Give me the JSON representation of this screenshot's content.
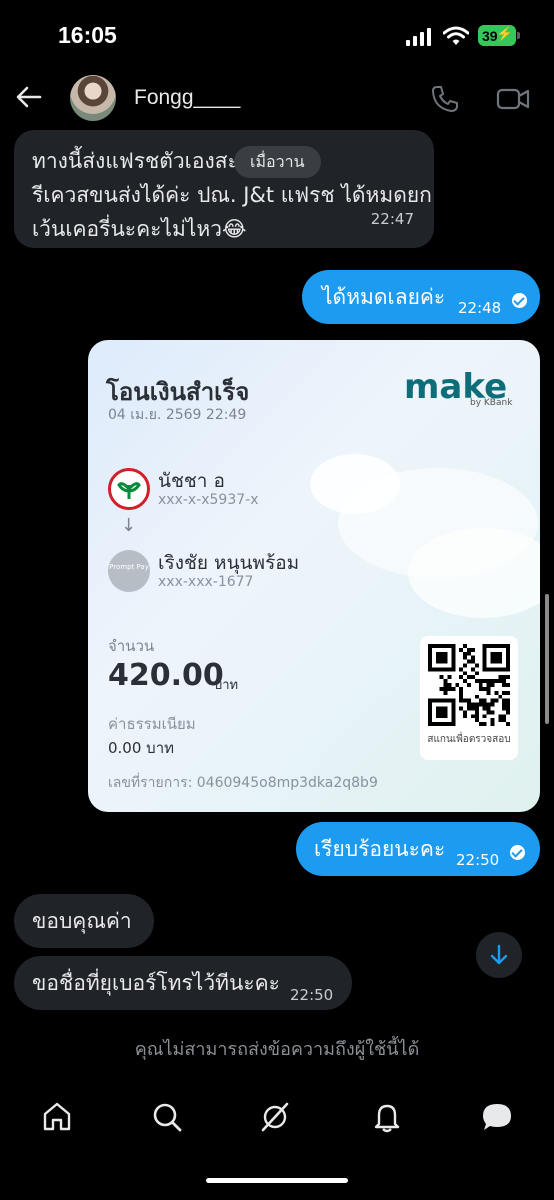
{
  "status": {
    "time": "16:05",
    "battery": "39"
  },
  "header": {
    "name": "Fongg____"
  },
  "timestamp_pill": "เมื่อวาน",
  "messages": [
    {
      "line1": "ทางนี้ส่งแฟรชตัวเองสะดวกกว่า",
      "line2": "รีเควสขนส่งได้ค่ะ ปณ. J&t แฟรช ได้หมดยก",
      "line3": "เว้นเคอรี่นะคะไม่ไหว😂",
      "time": "22:47"
    },
    {
      "text": "ได้หมดเลยค่ะ",
      "time": "22:48"
    },
    {
      "text": "เรียบร้อยนะคะ",
      "time": "22:50"
    },
    {
      "text": "ขอบคุณค่า"
    },
    {
      "text": "ขอชื่อที่ยุเบอร์โทรไว้ทีนะคะ",
      "time": "22:50"
    }
  ],
  "receipt": {
    "title": "โอนเงินสำเร็จ",
    "date": "04 เม.ย. 2569 22:49",
    "brand": "make",
    "brand_by": "by KBank",
    "sender_name": "นัชชา อ",
    "sender_account": "xxx-x-x5937-x",
    "promptpay_label": "Prompt Pay",
    "receiver_name": "เริงชัย หนุนพร้อม",
    "receiver_account": "xxx-xxx-1677",
    "amount_label": "จำนวน",
    "amount": "420.00",
    "amount_unit": "บาท",
    "fee_label": "ค่าธรรมเนียม",
    "fee": "0.00 บาท",
    "ref": "เลขที่รายการ: 0460945o8mp3dka2q8b9",
    "qr_label": "สแกนเพื่อตรวจสอบ"
  },
  "notice": "คุณไม่สามารถส่งข้อความถึงผู้ใช้นี้ได้",
  "nav": [
    "home-icon",
    "search-icon",
    "grok-icon",
    "notifications-icon",
    "messages-icon"
  ],
  "colors": {
    "accent": "#1d9bf0",
    "bubble_received": "#202327",
    "background": "#000000"
  }
}
